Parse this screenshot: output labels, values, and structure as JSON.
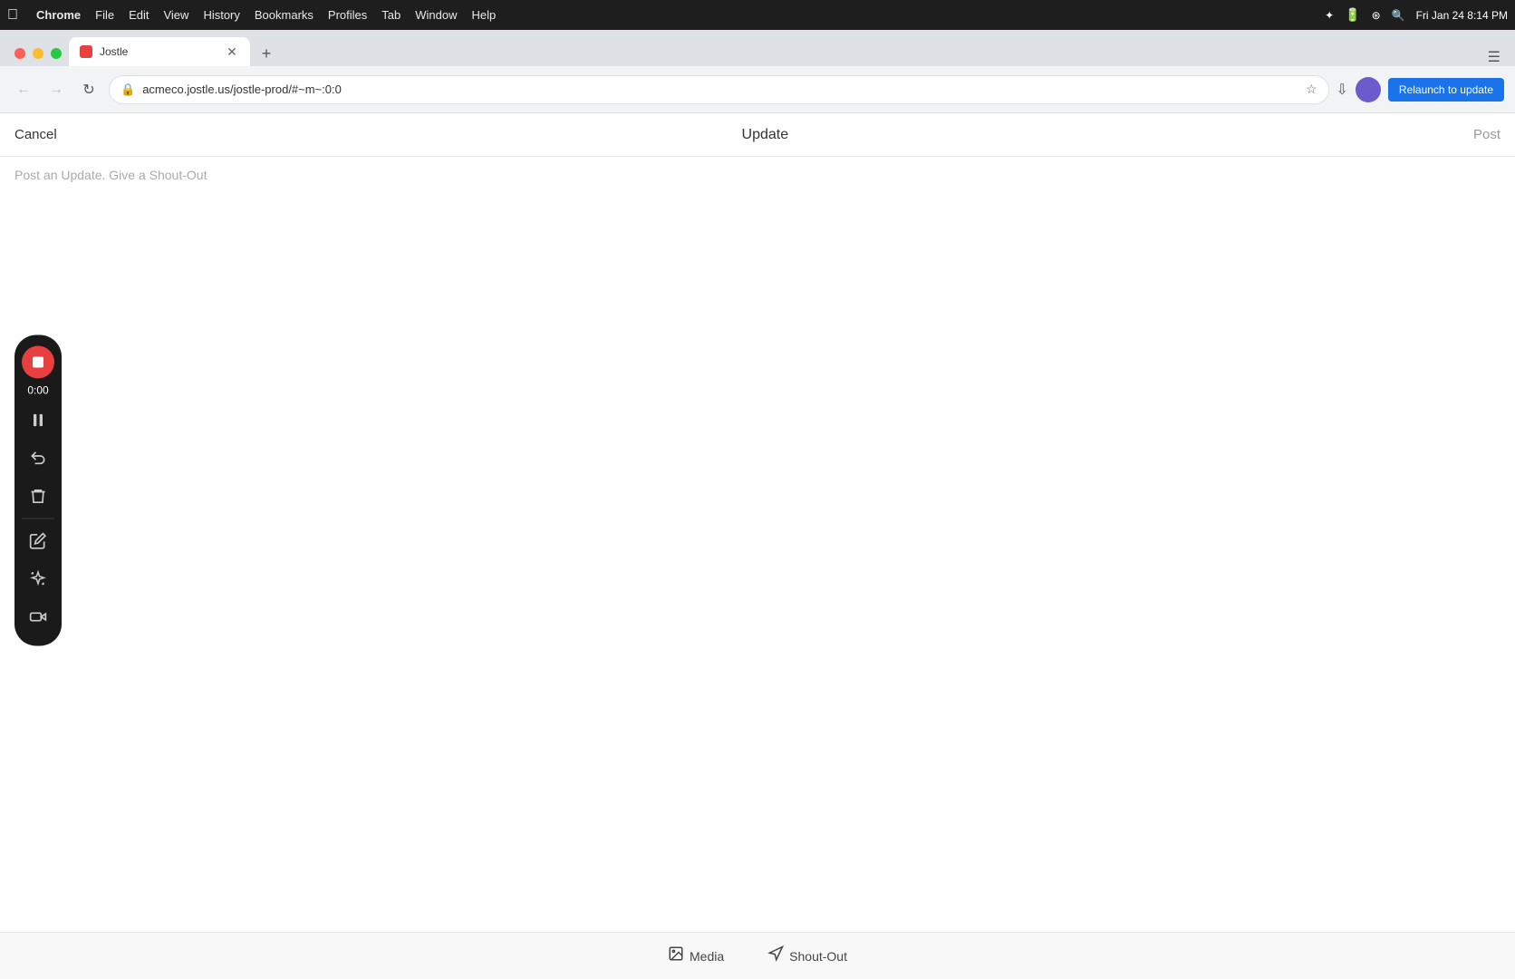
{
  "menubar": {
    "apple": "⌘",
    "items": [
      "Chrome",
      "File",
      "Edit",
      "View",
      "History",
      "Bookmarks",
      "Profiles",
      "Tab",
      "Window",
      "Help"
    ],
    "time": "Fri Jan 24  8:14 PM"
  },
  "tabbar": {
    "tab_title": "Jostle",
    "new_tab_label": "+",
    "controls_end": "≡"
  },
  "addressbar": {
    "url": "acmeco.jostle.us/jostle-prod/#~m~:0:0",
    "relaunch_label": "Relaunch to update"
  },
  "app": {
    "cancel_label": "Cancel",
    "title": "Update",
    "post_label": "Post",
    "placeholder": "Post an Update. Give a Shout-Out"
  },
  "toolbar": {
    "timer": "0:00",
    "buttons": [
      "pause",
      "undo",
      "trash",
      "pencil",
      "sparkles",
      "video"
    ]
  },
  "bottom": {
    "media_label": "Media",
    "shoutout_label": "Shout-Out"
  }
}
